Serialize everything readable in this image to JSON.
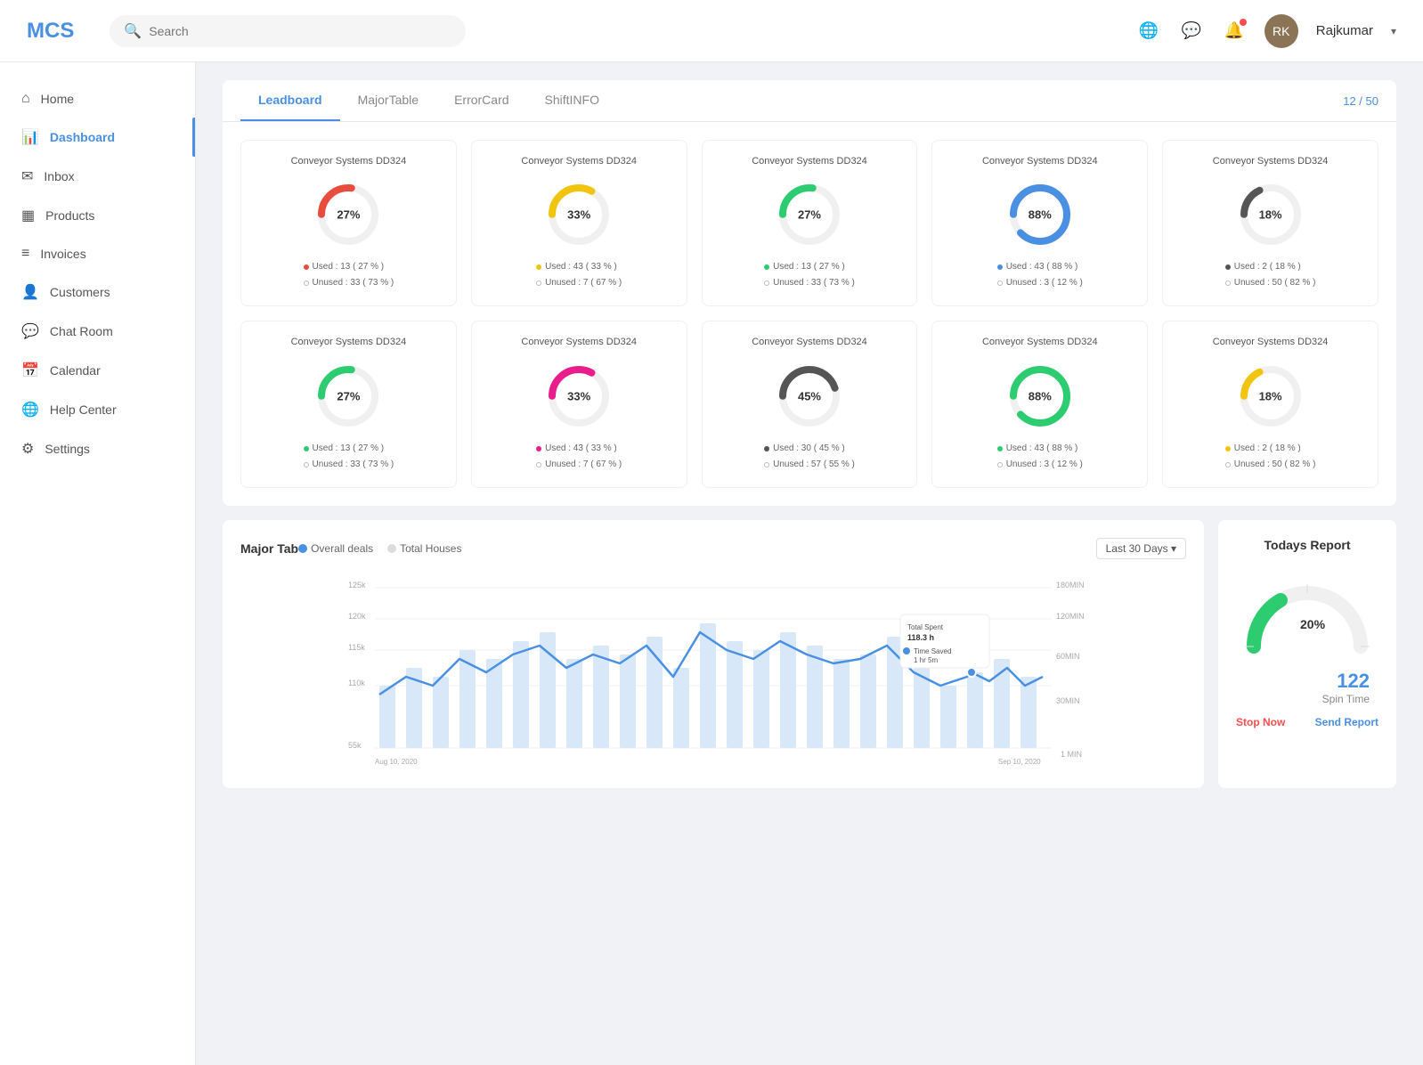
{
  "app": {
    "logo": "MCS",
    "search_placeholder": "Search"
  },
  "header": {
    "user_name": "Rajkumar",
    "page_counter": "12 / 50"
  },
  "sidebar": {
    "items": [
      {
        "id": "home",
        "label": "Home",
        "icon": "⌂"
      },
      {
        "id": "dashboard",
        "label": "Dashboard",
        "icon": "📊",
        "active": true
      },
      {
        "id": "inbox",
        "label": "Inbox",
        "icon": "✉"
      },
      {
        "id": "products",
        "label": "Products",
        "icon": "▦"
      },
      {
        "id": "invoices",
        "label": "Invoices",
        "icon": "≡"
      },
      {
        "id": "customers",
        "label": "Customers",
        "icon": "👤"
      },
      {
        "id": "chatroom",
        "label": "Chat Room",
        "icon": "💬"
      },
      {
        "id": "calendar",
        "label": "Calendar",
        "icon": "📅"
      },
      {
        "id": "helpcenter",
        "label": "Help Center",
        "icon": "🌐"
      },
      {
        "id": "settings",
        "label": "Settings",
        "icon": "⚙"
      }
    ]
  },
  "tabs": {
    "items": [
      {
        "label": "Leadboard",
        "active": true
      },
      {
        "label": "MajorTable",
        "active": false
      },
      {
        "label": "ErrorCard",
        "active": false
      },
      {
        "label": "ShiftINFO",
        "active": false
      }
    ],
    "counter": "12 / 50"
  },
  "cards": [
    {
      "title": "Conveyor Systems DD324",
      "pct": "27%",
      "color": "#E74C3C",
      "pct_num": 27,
      "used_label": "Used : 13 ( 27 % )",
      "unused_label": "Unused : 33 ( 73 % )",
      "used_color": "#E74C3C"
    },
    {
      "title": "Conveyor Systems DD324",
      "pct": "33%",
      "color": "#F1C40F",
      "pct_num": 33,
      "used_label": "Used : 43 ( 33 % )",
      "unused_label": "Unused : 7 ( 67 % )",
      "used_color": "#F1C40F"
    },
    {
      "title": "Conveyor Systems DD324",
      "pct": "27%",
      "color": "#2ECC71",
      "pct_num": 27,
      "used_label": "Used : 13 ( 27 % )",
      "unused_label": "Unused : 33 ( 73 % )",
      "used_color": "#2ECC71"
    },
    {
      "title": "Conveyor Systems DD324",
      "pct": "88%",
      "color": "#4A90E2",
      "pct_num": 88,
      "used_label": "Used : 43 ( 88 % )",
      "unused_label": "Unused : 3 ( 12 % )",
      "used_color": "#4A90E2"
    },
    {
      "title": "Conveyor Systems DD324",
      "pct": "18%",
      "color": "#555",
      "pct_num": 18,
      "used_label": "Used : 2 ( 18 % )",
      "unused_label": "Unused : 50 ( 82 % )",
      "used_color": "#555"
    },
    {
      "title": "Conveyor Systems DD324",
      "pct": "27%",
      "color": "#2ECC71",
      "pct_num": 27,
      "used_label": "Used : 13 ( 27 % )",
      "unused_label": "Unused : 33 ( 73 % )",
      "used_color": "#2ECC71"
    },
    {
      "title": "Conveyor Systems DD324",
      "pct": "33%",
      "color": "#E91E8C",
      "pct_num": 33,
      "used_label": "Used : 43 ( 33 % )",
      "unused_label": "Unused : 7 ( 67 % )",
      "used_color": "#E91E8C"
    },
    {
      "title": "Conveyor Systems DD324",
      "pct": "45%",
      "color": "#555",
      "pct_num": 45,
      "used_label": "Used : 30 ( 45 % )",
      "unused_label": "Unused : 57 ( 55 % )",
      "used_color": "#555"
    },
    {
      "title": "Conveyor Systems DD324",
      "pct": "88%",
      "color": "#2ECC71",
      "pct_num": 88,
      "used_label": "Used : 43 ( 88 % )",
      "unused_label": "Unused : 3 ( 12 % )",
      "used_color": "#2ECC71"
    },
    {
      "title": "Conveyor Systems DD324",
      "pct": "18%",
      "color": "#F1C40F",
      "pct_num": 18,
      "used_label": "Used : 2 ( 18 % )",
      "unused_label": "Unused : 50 ( 82 % )",
      "used_color": "#F1C40F"
    }
  ],
  "chart": {
    "title": "Major Tab",
    "legend_overall": "Overall deals",
    "legend_houses": "Total Houses",
    "date_filter": "Last 30 Days",
    "x_labels": [
      "Aug 10, 2020",
      "",
      "",
      "",
      "",
      "",
      "",
      "",
      "",
      "",
      "",
      "",
      "",
      "",
      "",
      "",
      "",
      "",
      "",
      "",
      "",
      "Sep 10, 2020"
    ],
    "y_labels_left": [
      "125k",
      "120k",
      "115k",
      "110k",
      "55k"
    ],
    "y_labels_right": [
      "180MIN",
      "120MIN",
      "60MIN",
      "30MIN",
      "1 MIN"
    ],
    "tooltip": {
      "total_spent_label": "Total Spent",
      "total_spent_value": "118.3 h",
      "time_saved_label": "Time Saved",
      "time_saved_value": "1 hr 5m"
    }
  },
  "report": {
    "title": "Todays Report",
    "gauge_pct": "20%",
    "value": "122",
    "spin_time_label": "Spin Time",
    "stop_btn": "Stop Now",
    "send_btn": "Send Report"
  }
}
